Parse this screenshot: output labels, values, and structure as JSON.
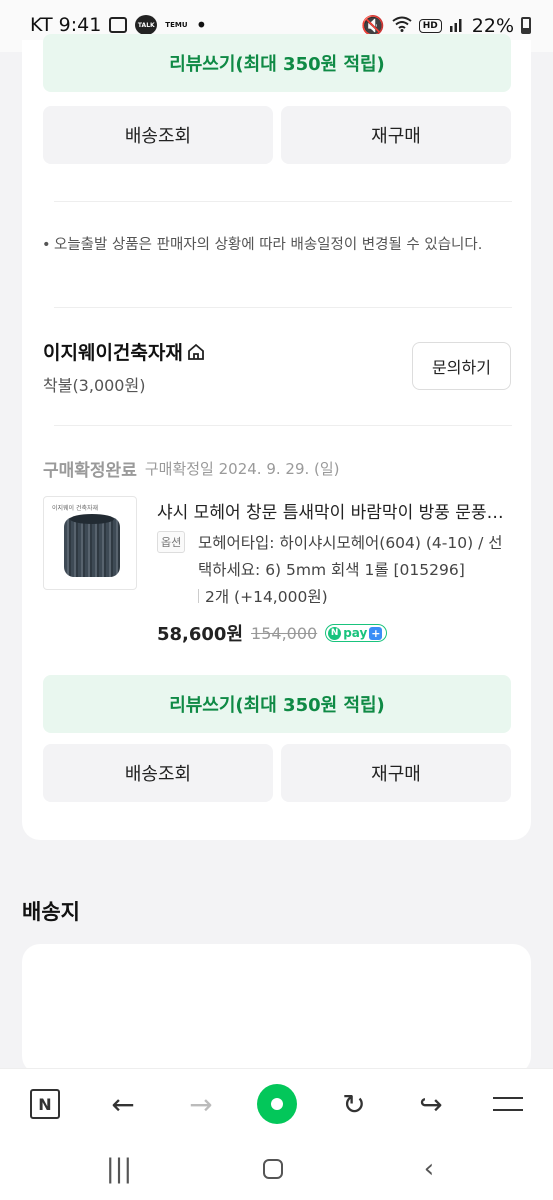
{
  "status_bar": {
    "carrier_time": "KT 9:41",
    "talk": "TALK",
    "temu": "TEMU",
    "dot": "•",
    "hd": "HD",
    "battery": "22%"
  },
  "orders": [
    {
      "review_button": "리뷰쓰기(최대 350원 적립)",
      "track_button": "배송조회",
      "rebuy_button": "재구매"
    },
    {
      "status": "구매확정완료",
      "confirm_date": "구매확정일 2024. 9. 29. (일)",
      "product_name": "샤시 모헤어 창문 틈새막이 바람막이 방풍 문풍지 외풍 차단 모헤어",
      "option_tag": "옵션",
      "option_text": "모헤어타입: 하이샤시모헤어(604) (4-10) / 선택하세요: 6) 5mm 회색 1롤 [015296]",
      "quantity_text": "2개 (+14,000원)",
      "price": "58,600원",
      "original_price": "154,000",
      "npay": "pay",
      "review_button": "리뷰쓰기(최대 350원 적립)",
      "track_button": "배송조회",
      "rebuy_button": "재구매"
    }
  ],
  "notice": "오늘출발 상품은 판매자의 상황에 따라 배송일정이 변경될 수 있습니다.",
  "seller": {
    "name": "이지웨이건축자재",
    "shipping": "착불(3,000원)",
    "inquiry_button": "문의하기"
  },
  "thumbnail_brand": "이지웨이 건축자재",
  "shipping_section": {
    "title": "배송지"
  },
  "toolbar": {
    "n_label": "N",
    "back": "←",
    "forward": "→",
    "refresh": "↻",
    "share": "↪"
  },
  "navbar": {
    "recent": "|||",
    "back": "‹"
  },
  "colors": {
    "green_accent": "#0f8a45",
    "green_bg": "#e9f7ef",
    "naver_green": "#03c75a"
  }
}
